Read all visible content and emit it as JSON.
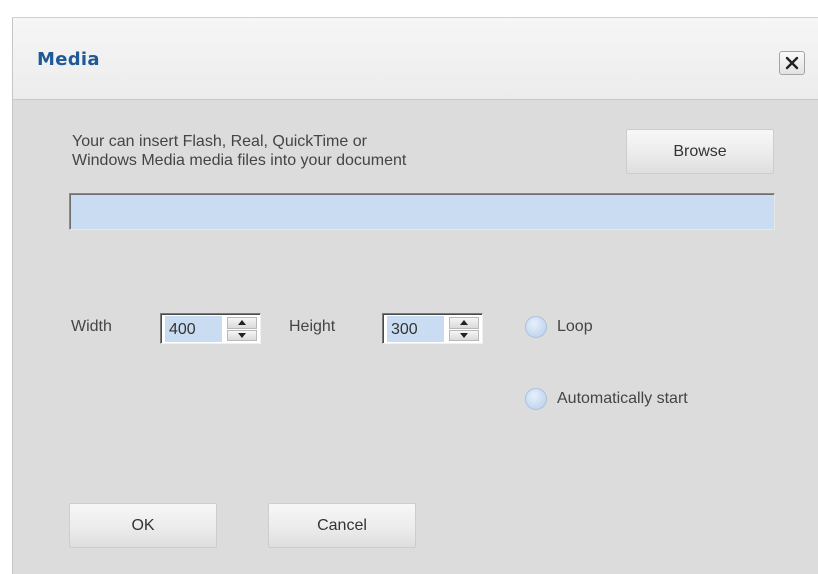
{
  "dialog": {
    "title": "Media",
    "close_icon": "close-icon",
    "description_line1": "Your can insert Flash, Real, QuickTime or",
    "description_line2": "Windows Media media files into your document",
    "browse_label": "Browse",
    "file_path_value": "",
    "width_label": "Width",
    "width_value": "400",
    "height_label": "Height",
    "height_value": "300",
    "loop_label": "Loop",
    "loop_checked": false,
    "autostart_label": "Automatically start",
    "autostart_checked": false,
    "ok_label": "OK",
    "cancel_label": "Cancel"
  },
  "colors": {
    "title": "#1f5a96",
    "input_fill": "#c9dcf1",
    "dialog_bg": "#dcdcdc"
  }
}
